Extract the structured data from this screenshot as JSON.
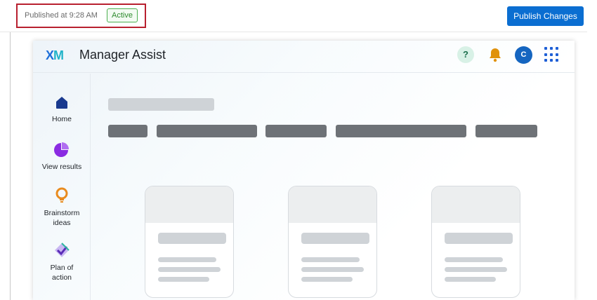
{
  "topbar": {
    "published_text": "Published at 9:28 AM",
    "status_badge": "Active",
    "publish_button": "Publish Changes"
  },
  "app": {
    "logo": "XM",
    "title": "Manager Assist",
    "help_icon": "?",
    "avatar_initial": "C"
  },
  "sidebar": {
    "items": [
      {
        "label": "Home",
        "icon": "home-icon"
      },
      {
        "label": "View results",
        "icon": "pie-chart-icon"
      },
      {
        "label": "Brainstorm ideas",
        "icon": "lightbulb-icon"
      },
      {
        "label": "Plan of action",
        "icon": "diamond-check-icon"
      }
    ]
  },
  "colors": {
    "publish_button": "#0b6ed1",
    "active_badge": "#2d8a2d",
    "highlight_box": "#b8202f",
    "home_icon": "#1a3a8f",
    "view_results_icon": "#8a2be2",
    "brainstorm_icon": "#e98b1f",
    "bell_icon": "#e0920c"
  }
}
